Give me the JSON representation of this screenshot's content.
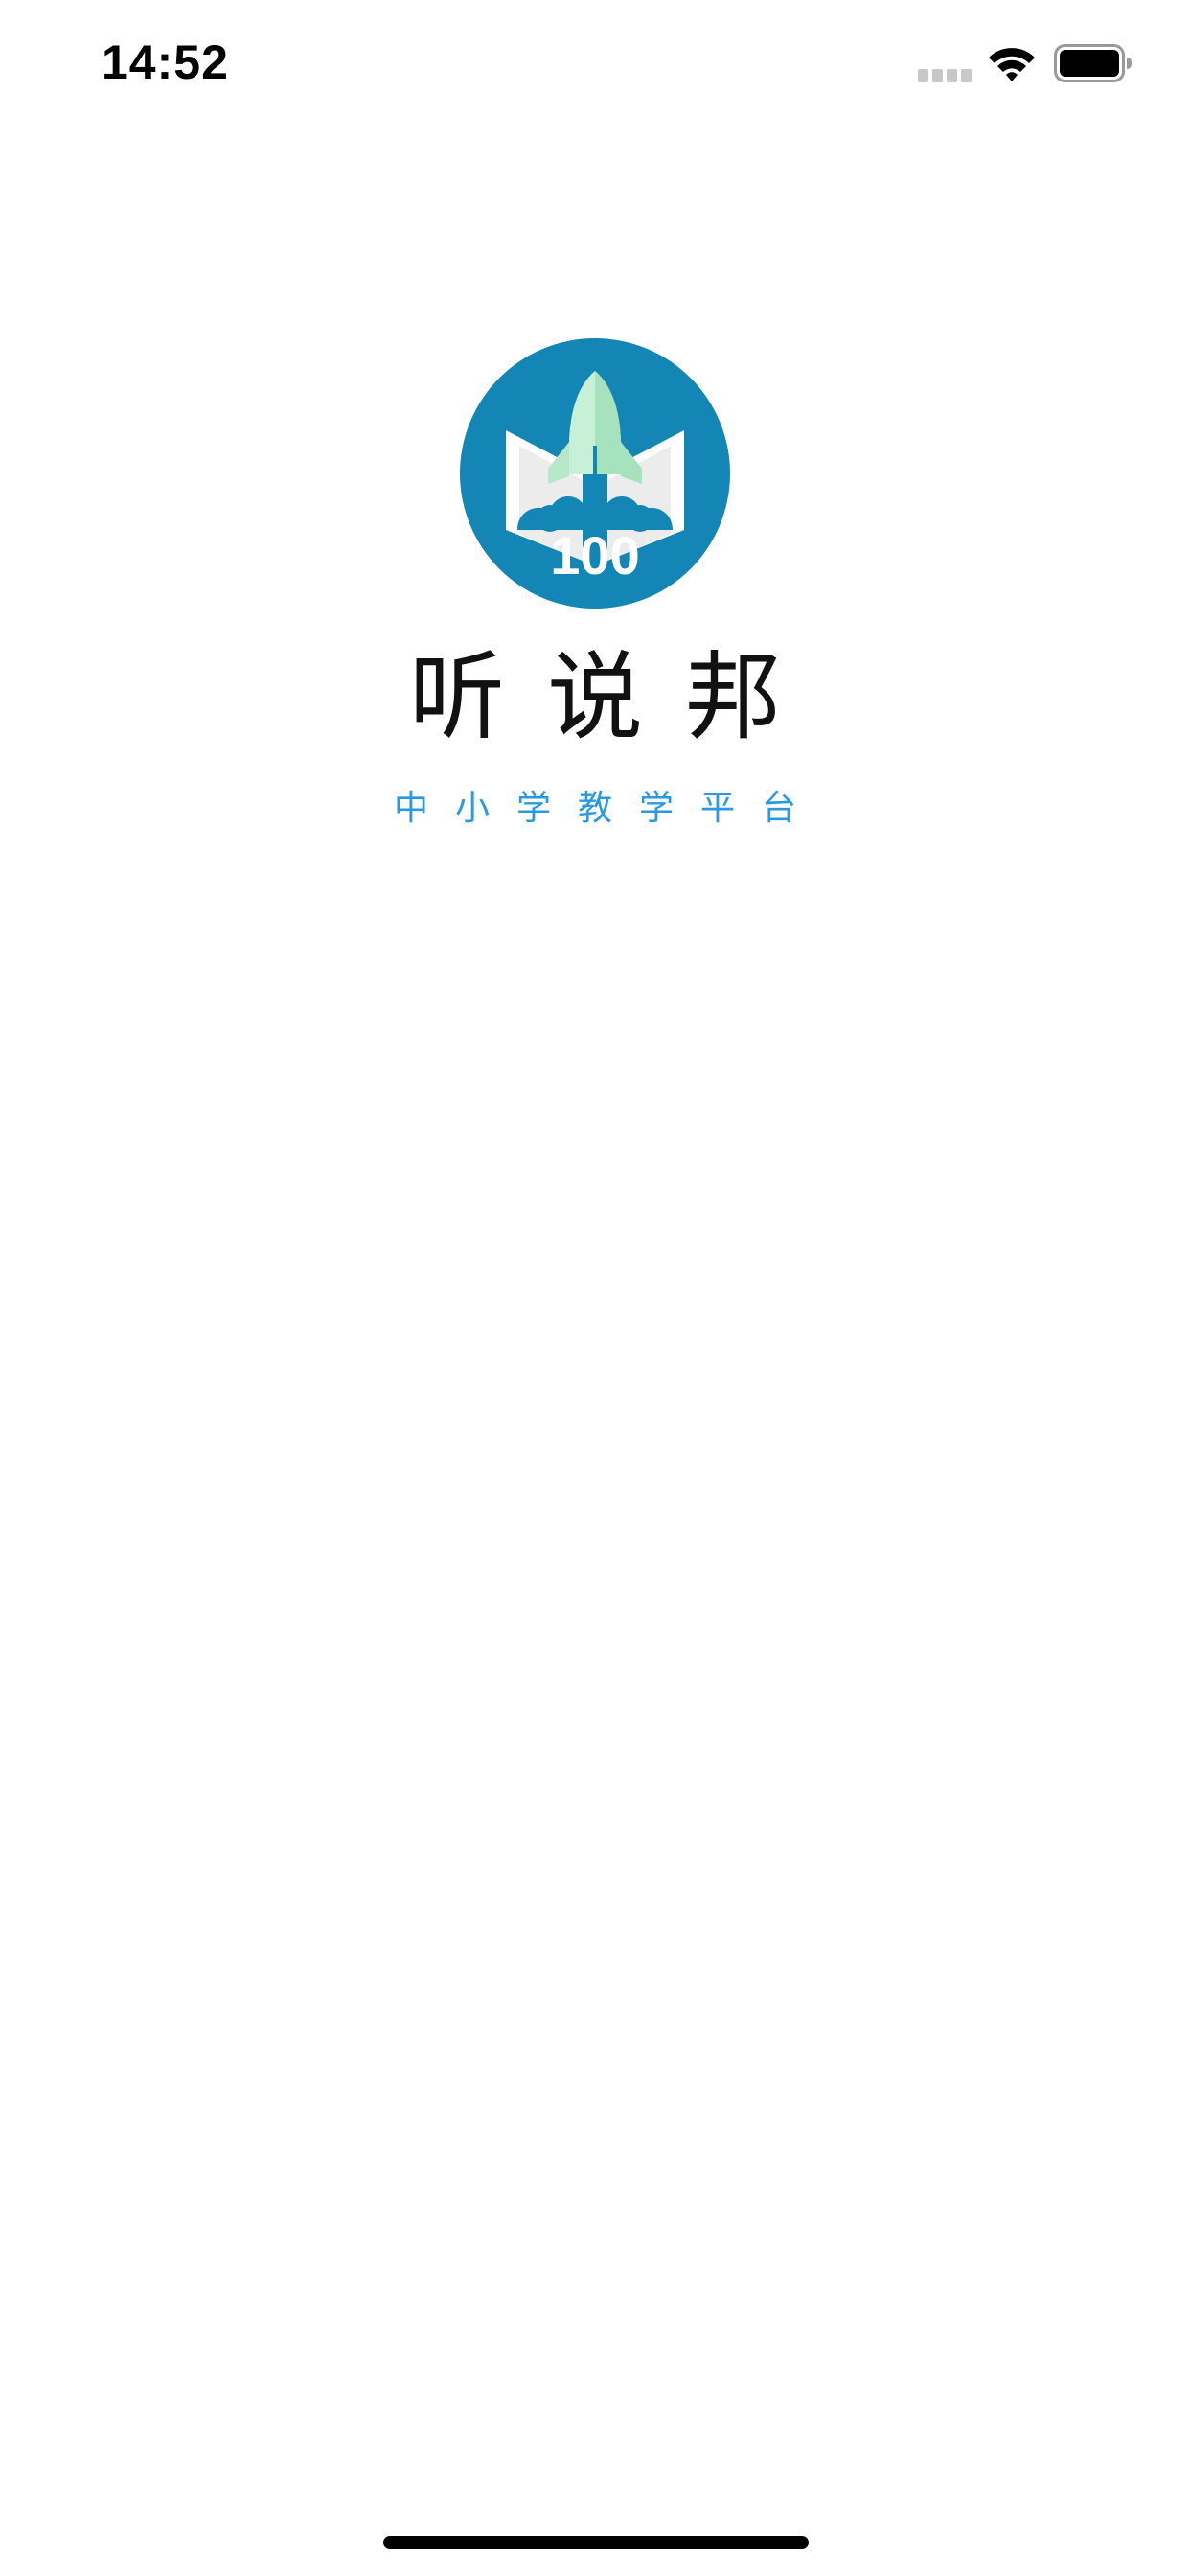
{
  "status_bar": {
    "time": "14:52",
    "signal_icon": "cellular-signal-icon",
    "wifi_icon": "wifi-icon",
    "battery_icon": "battery-icon"
  },
  "splash": {
    "logo_badge_text": "100",
    "app_name": "听说邦",
    "slogan": "中小学教学平台"
  },
  "colors": {
    "logo_circle": "#1486b5",
    "rocket_green": "#b6e8c8",
    "slogan_blue": "#2a9ae0",
    "text_dark": "#111111"
  }
}
